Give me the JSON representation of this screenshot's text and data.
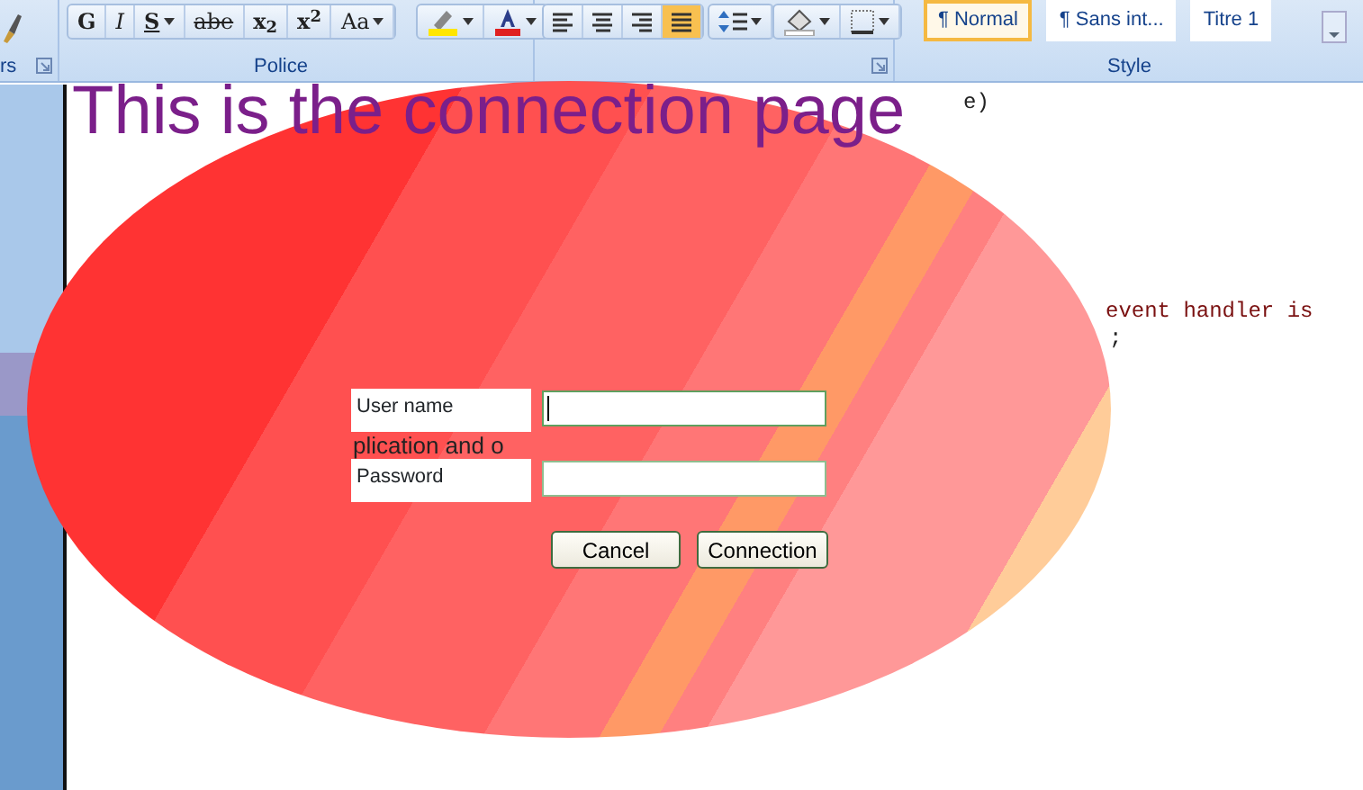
{
  "ribbon": {
    "clipboard_label": "rs",
    "font_buttons": [
      {
        "text": "G",
        "kind": "bold",
        "dropdown": false
      },
      {
        "text": "I",
        "kind": "italic",
        "dropdown": false
      },
      {
        "text": "S",
        "kind": "underline",
        "dropdown": true
      },
      {
        "text": "abe",
        "kind": "strike",
        "dropdown": false
      },
      {
        "text": "x$_{2}$",
        "kind": "sub",
        "dropdown": false
      },
      {
        "text": "x$^{2}$",
        "kind": "sup",
        "dropdown": false
      },
      {
        "text": "Aa",
        "kind": "case",
        "dropdown": true
      }
    ],
    "font_group_label": "Police",
    "styles": [
      {
        "label": "¶ Normal",
        "selected": true
      },
      {
        "label": "¶ Sans int...",
        "selected": false
      },
      {
        "label": "Titre 1",
        "selected": false
      }
    ],
    "style_group_label": "Style"
  },
  "document": {
    "heading": "This is the connection page",
    "code": {
      "line_1_end": "e)",
      "line_9_end": "event handler is",
      "line_10_end": ";"
    },
    "text_fragment": "plication and o"
  },
  "form": {
    "fields": [
      {
        "label": "User name",
        "focused": true
      },
      {
        "label": "Password",
        "focused": false
      }
    ],
    "buttons": [
      "Cancel",
      "Connection"
    ]
  }
}
